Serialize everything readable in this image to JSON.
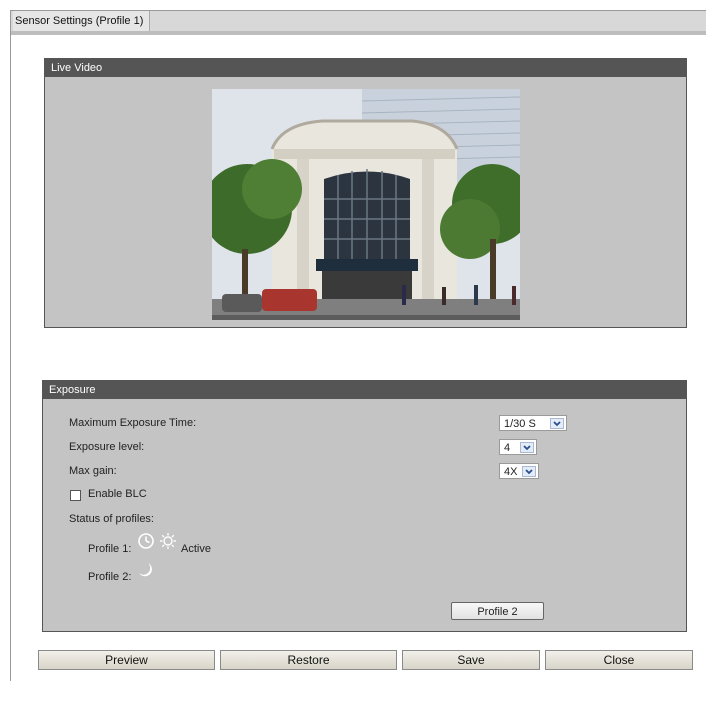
{
  "window": {
    "title": "Sensor Settings (Profile 1)"
  },
  "live_video": {
    "header": "Live Video"
  },
  "exposure": {
    "header": "Exposure",
    "max_exposure_time": {
      "label": "Maximum Exposure Time:",
      "value": "1/30 S"
    },
    "exposure_level": {
      "label": "Exposure level:",
      "value": "4"
    },
    "max_gain": {
      "label": "Max gain:",
      "value": "4X"
    },
    "enable_blc": {
      "label": "Enable BLC",
      "checked": false
    },
    "status_label": "Status of profiles:",
    "profile1": {
      "label": "Profile 1:",
      "status": "Active"
    },
    "profile2": {
      "label": "Profile 2:"
    },
    "profile_button": "Profile 2"
  },
  "buttons": {
    "preview": "Preview",
    "restore": "Restore",
    "save": "Save",
    "close": "Close"
  }
}
